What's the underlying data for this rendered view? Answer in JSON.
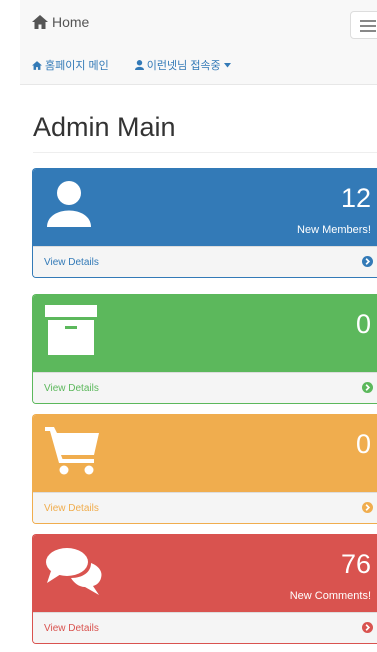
{
  "navbar": {
    "brand": "Home",
    "links": [
      {
        "label": "홈페이지 메인",
        "icon": "home-icon"
      },
      {
        "label": "이런넷님 접속중",
        "icon": "user-icon"
      }
    ]
  },
  "page_title": "Admin Main",
  "panels": [
    {
      "count": "12",
      "subtitle": "New Members!",
      "details": "View Details",
      "icon": "user-icon",
      "color": "#337ab7"
    },
    {
      "count": "0",
      "subtitle": "",
      "details": "View Details",
      "icon": "archive-icon",
      "color": "#5cb85c"
    },
    {
      "count": "0",
      "subtitle": "",
      "details": "View Details",
      "icon": "shopping-cart-icon",
      "color": "#f0ad4e"
    },
    {
      "count": "76",
      "subtitle": "New Comments!",
      "details": "View Details",
      "icon": "comments-icon",
      "color": "#d9534f"
    }
  ]
}
